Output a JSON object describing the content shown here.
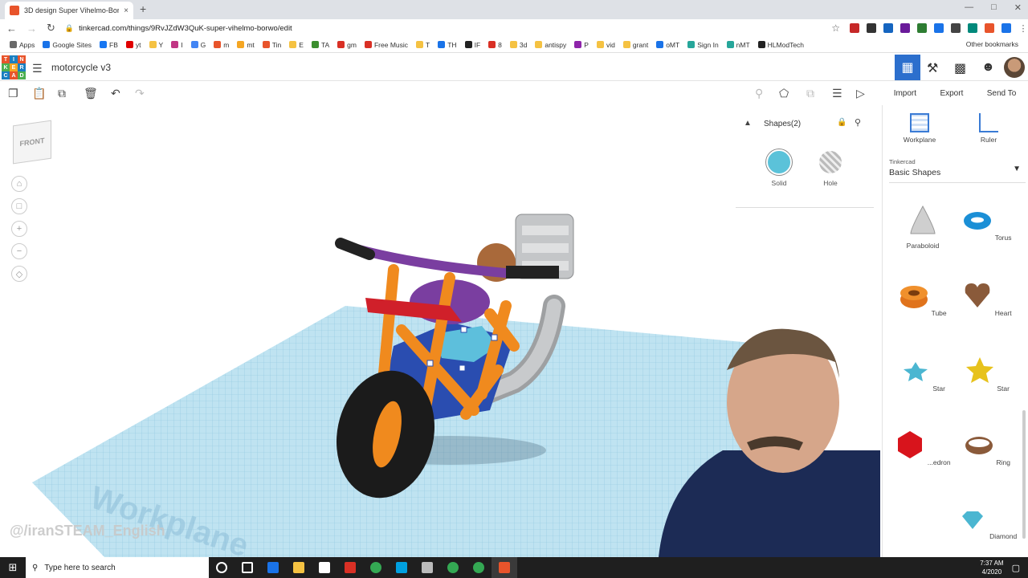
{
  "browser": {
    "tab_title": "3D design Super Vihelmo-Borwo",
    "new_tab_symbol": "+",
    "close_symbol": "×",
    "url": "tinkercad.com/things/9RvJZdW3QuK-super-vihelmo-borwo/edit",
    "bookmarks": [
      {
        "label": "Apps",
        "color": "#6a6a6a"
      },
      {
        "label": "Google Sites",
        "color": "#1a73e8"
      },
      {
        "label": "FB",
        "color": "#1877f2"
      },
      {
        "label": "yt",
        "color": "#e00000"
      },
      {
        "label": "Y",
        "color": "#f5c242"
      },
      {
        "label": "I",
        "color": "#c13584"
      },
      {
        "label": "G",
        "color": "#4285f4"
      },
      {
        "label": "m",
        "color": "#e8542b"
      },
      {
        "label": "mt",
        "color": "#f5a623"
      },
      {
        "label": "Tin",
        "color": "#e8542b"
      },
      {
        "label": "E",
        "color": "#f5c242"
      },
      {
        "label": "TA",
        "color": "#3b8e2e"
      },
      {
        "label": "gm",
        "color": "#d93025"
      },
      {
        "label": "Free Music",
        "color": "#d93025"
      },
      {
        "label": "T",
        "color": "#f5c242"
      },
      {
        "label": "TH",
        "color": "#1a73e8"
      },
      {
        "label": "IF",
        "color": "#222222"
      },
      {
        "label": "8",
        "color": "#d93025"
      },
      {
        "label": "3d",
        "color": "#f5c242"
      },
      {
        "label": "antispy",
        "color": "#f5c242"
      },
      {
        "label": "P",
        "color": "#8e24aa"
      },
      {
        "label": "vid",
        "color": "#f5c242"
      },
      {
        "label": "grant",
        "color": "#f5c242"
      },
      {
        "label": "oMT",
        "color": "#1a73e8"
      },
      {
        "label": "Sign In",
        "color": "#26a69a"
      },
      {
        "label": "nMT",
        "color": "#26a69a"
      },
      {
        "label": "HLModTech",
        "color": "#222222"
      }
    ],
    "other_bookmarks": "Other bookmarks"
  },
  "header": {
    "logo_letters": [
      "T",
      "I",
      "N",
      "K",
      "E",
      "R",
      "C",
      "A",
      "D"
    ],
    "logo_colors": [
      "#e8542b",
      "#1a7fc1",
      "#e8542b",
      "#4caf50",
      "#f5a623",
      "#1a7fc1",
      "#1a7fc1",
      "#e8542b",
      "#4caf50"
    ],
    "design_title": "motorcycle v3"
  },
  "toolbar_right": {
    "import": "Import",
    "export": "Export",
    "send_to": "Send To"
  },
  "workspace": {
    "viewcube_label": "FRONT",
    "watermark": "@/iranSTEAM_English",
    "workplane_text": "Workplane"
  },
  "inspector": {
    "title": "Shapes(2)",
    "solid_label": "Solid",
    "hole_label": "Hole",
    "solid_color": "#5bc2d9"
  },
  "panel": {
    "workplane": "Workplane",
    "ruler": "Ruler",
    "library_small": "Tinkercad",
    "library_name": "Basic Shapes",
    "shapes": [
      {
        "label": "Paraboloid",
        "icon": "paraboloid-icon"
      },
      {
        "label": "Torus",
        "icon": "torus-icon"
      },
      {
        "label": "Tube",
        "icon": "tube-icon"
      },
      {
        "label": "Heart",
        "icon": "heart-icon"
      },
      {
        "label": "Star",
        "icon": "star-icon"
      },
      {
        "label": "Star",
        "icon": "star-icon"
      },
      {
        "label": "...edron",
        "icon": "polyhedron-icon"
      },
      {
        "label": "Ring",
        "icon": "ring-icon"
      },
      {
        "label": "Diamond",
        "icon": "diamond-icon"
      }
    ]
  },
  "taskbar": {
    "search_placeholder": "Type here to search",
    "time": "7:37 AM",
    "date": "4/2020"
  }
}
